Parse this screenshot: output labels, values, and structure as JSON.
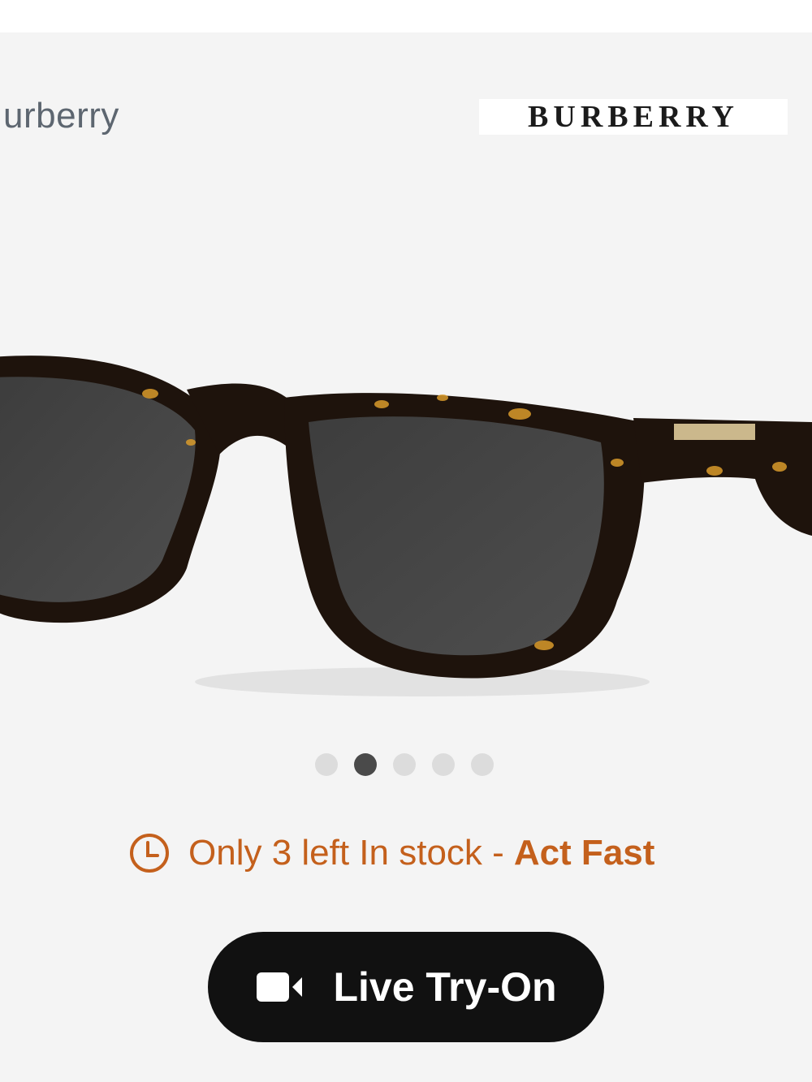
{
  "product": {
    "brand_partial": "urberry",
    "logo_text": "BURBERRY"
  },
  "gallery": {
    "dot_count": 5,
    "active_index": 1
  },
  "stock": {
    "message": "Only 3 left In stock -",
    "urgency": "Act Fast",
    "icon": "clock-icon",
    "color": "#c4601c"
  },
  "try_on": {
    "label": "Live Try-On",
    "icon": "video-camera-icon"
  }
}
